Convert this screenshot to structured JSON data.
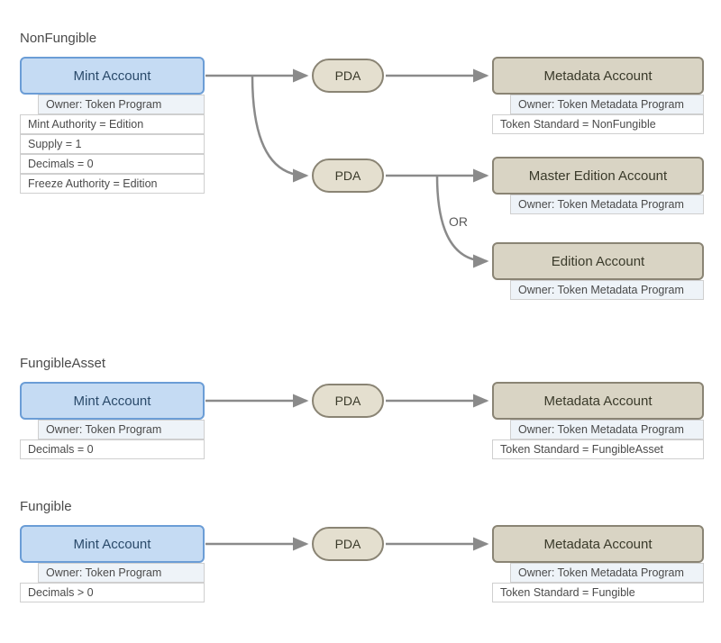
{
  "colors": {
    "mint_bg": "#c5dbf3",
    "mint_border": "#6b9dd6",
    "meta_bg": "#d9d4c4",
    "meta_border": "#8a8474",
    "arrow": "#8a8a8a"
  },
  "sections": {
    "nonfungible": {
      "label": "NonFungible",
      "mint": {
        "title": "Mint Account",
        "owner": "Owner: Token Program",
        "rows": [
          "Mint Authority = Edition",
          "Supply = 1",
          "Decimals = 0",
          "Freeze Authority = Edition"
        ]
      },
      "pda1": "PDA",
      "pda2": "PDA",
      "metadata": {
        "title": "Metadata Account",
        "owner": "Owner: Token Metadata Program",
        "row": "Token Standard = NonFungible"
      },
      "master_edition": {
        "title": "Master Edition Account",
        "owner": "Owner: Token Metadata Program"
      },
      "or_label": "OR",
      "edition": {
        "title": "Edition Account",
        "owner": "Owner: Token Metadata Program"
      }
    },
    "fungible_asset": {
      "label": "FungibleAsset",
      "mint": {
        "title": "Mint Account",
        "owner": "Owner: Token Program",
        "row": "Decimals = 0"
      },
      "pda": "PDA",
      "metadata": {
        "title": "Metadata Account",
        "owner": "Owner: Token Metadata Program",
        "row": "Token Standard = FungibleAsset"
      }
    },
    "fungible": {
      "label": "Fungible",
      "mint": {
        "title": "Mint Account",
        "owner": "Owner: Token Program",
        "row": "Decimals > 0"
      },
      "pda": "PDA",
      "metadata": {
        "title": "Metadata Account",
        "owner": "Owner: Token Metadata Program",
        "row": "Token Standard = Fungible"
      }
    }
  }
}
